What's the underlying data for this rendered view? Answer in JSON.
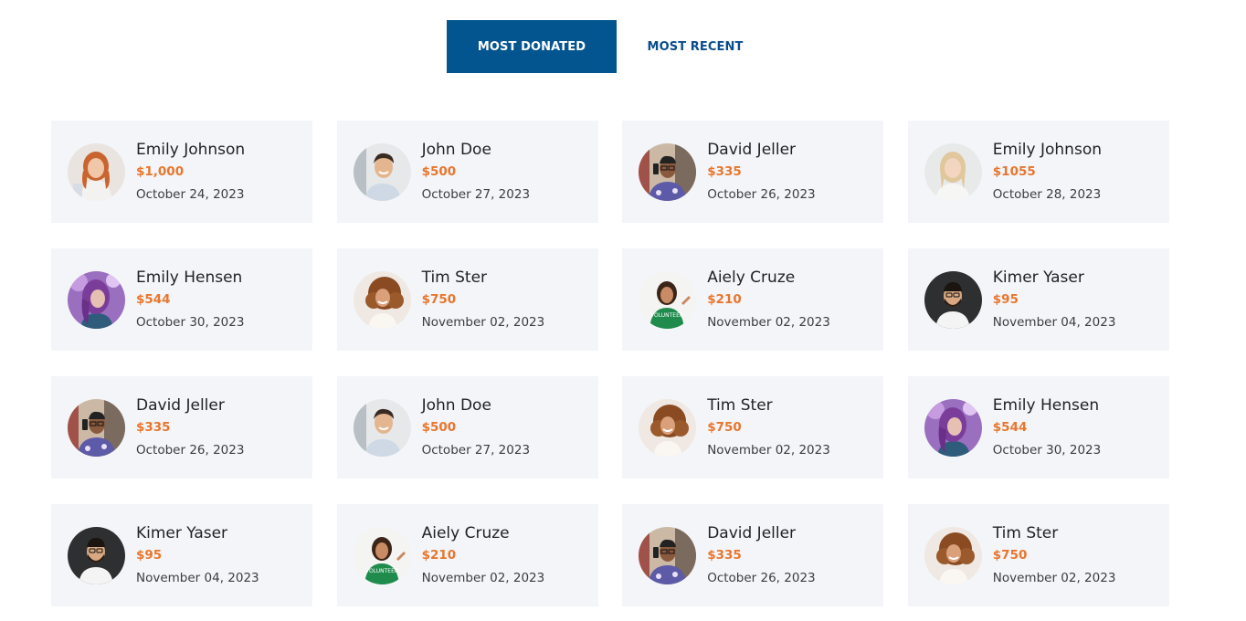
{
  "tabs": [
    {
      "label": "MOST DONATED",
      "active": true
    },
    {
      "label": "MOST RECENT",
      "active": false
    }
  ],
  "donors": [
    {
      "name": "Emily Johnson",
      "amount": "$1,000",
      "date": "October 24, 2023",
      "avatar": "woman-redhair-icon"
    },
    {
      "name": "John Doe",
      "amount": "$500",
      "date": "October 27, 2023",
      "avatar": "man-smiling-icon"
    },
    {
      "name": "David Jeller",
      "amount": "$335",
      "date": "October 26, 2023",
      "avatar": "man-glasses-phone-icon"
    },
    {
      "name": "Emily Johnson",
      "amount": "$1055",
      "date": "October 28, 2023",
      "avatar": "woman-blonde-icon"
    },
    {
      "name": "Emily Hensen",
      "amount": "$544",
      "date": "October 30, 2023",
      "avatar": "woman-purplehair-icon"
    },
    {
      "name": "Tim Ster",
      "amount": "$750",
      "date": "November 02, 2023",
      "avatar": "woman-curlyhair-icon"
    },
    {
      "name": "Aiely Cruze",
      "amount": "$210",
      "date": "November 02, 2023",
      "avatar": "woman-volunteer-icon"
    },
    {
      "name": "Kimer Yaser",
      "amount": "$95",
      "date": "November 04, 2023",
      "avatar": "man-beard-glasses-icon"
    },
    {
      "name": "David Jeller",
      "amount": "$335",
      "date": "October 26, 2023",
      "avatar": "man-glasses-phone-icon"
    },
    {
      "name": "John Doe",
      "amount": "$500",
      "date": "October 27, 2023",
      "avatar": "man-smiling-icon"
    },
    {
      "name": "Tim Ster",
      "amount": "$750",
      "date": "November 02, 2023",
      "avatar": "woman-curlyhair-icon"
    },
    {
      "name": "Emily Hensen",
      "amount": "$544",
      "date": "October 30, 2023",
      "avatar": "woman-purplehair-icon"
    },
    {
      "name": "Kimer Yaser",
      "amount": "$95",
      "date": "November 04, 2023",
      "avatar": "man-beard-glasses-icon"
    },
    {
      "name": "Aiely Cruze",
      "amount": "$210",
      "date": "November 02, 2023",
      "avatar": "woman-volunteer-icon"
    },
    {
      "name": "David Jeller",
      "amount": "$335",
      "date": "October 26, 2023",
      "avatar": "man-glasses-phone-icon"
    },
    {
      "name": "Tim Ster",
      "amount": "$750",
      "date": "November 02, 2023",
      "avatar": "woman-curlyhair-icon"
    }
  ],
  "colors": {
    "accent": "#03558f",
    "amount": "#e8762d",
    "card_bg": "#f3f5f8"
  }
}
